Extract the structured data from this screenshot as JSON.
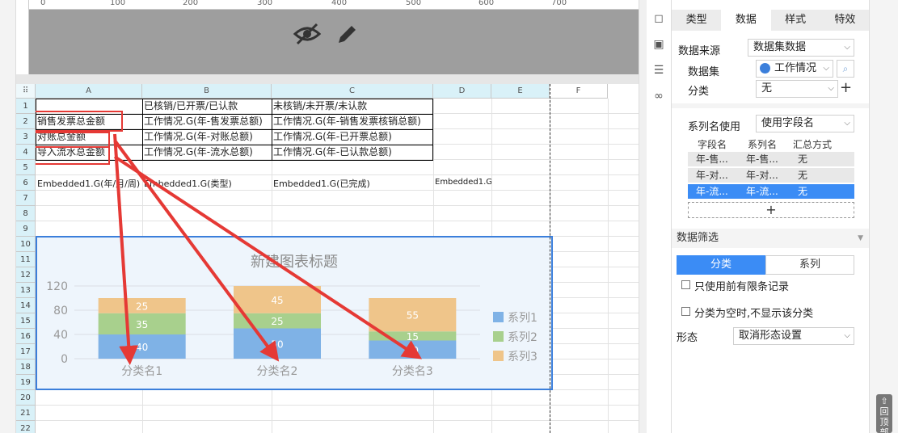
{
  "ruler_ticks": [
    "0",
    "100",
    "200",
    "300",
    "400",
    "500",
    "600",
    "700"
  ],
  "columns": [
    "A",
    "B",
    "C",
    "D",
    "E",
    "F"
  ],
  "rows": [
    "1",
    "2",
    "3",
    "4",
    "5",
    "6",
    "7",
    "8",
    "9",
    "10",
    "11",
    "12",
    "13",
    "14",
    "15",
    "16",
    "17",
    "18",
    "19",
    "20",
    "21",
    "22"
  ],
  "cells": {
    "B1": "已核销/已开票/已认款",
    "C1": "未核销/未开票/未认款",
    "A2": "销售发票总金额",
    "B2": "工作情况.G(年-售发票总额)",
    "C2": "工作情况.G(年-销售发票核销总额)",
    "A3": "对账总金额",
    "B3": "工作情况.G(年-对账总额)",
    "C3": "工作情况.G(年-已开票总额)",
    "A4": "导入流水总金额",
    "B4": "工作情况.G(年-流水总额)",
    "C4": "工作情况.G(年-已认款总额)",
    "A6": "Embedded1.G(年/月/周)",
    "B6": "Embedded1.G(类型)",
    "C6": "Embedded1.G(已完成)",
    "D6": "Embedded1.G"
  },
  "chart_data": {
    "type": "bar",
    "stacked": true,
    "title": "新建图表标题",
    "categories": [
      "分类名1",
      "分类名2",
      "分类名3"
    ],
    "series": [
      {
        "name": "系列1",
        "values": [
          40,
          50,
          30
        ],
        "color": "#7fb2e6"
      },
      {
        "name": "系列2",
        "values": [
          35,
          25,
          15
        ],
        "color": "#a8d08d"
      },
      {
        "name": "系列3",
        "values": [
          25,
          45,
          55
        ],
        "color": "#efc58a"
      }
    ],
    "data_labels": [
      [
        "40",
        "35",
        "25"
      ],
      [
        "50",
        "25",
        "45"
      ],
      [
        "10",
        "15",
        "55"
      ]
    ],
    "ylim": [
      0,
      120
    ],
    "yticks": [
      "0",
      "40",
      "80",
      "120"
    ],
    "legend": "right",
    "grid": true
  },
  "panel": {
    "tabs": [
      "类型",
      "数据",
      "样式",
      "特效"
    ],
    "active_tab": "数据",
    "data_source_label": "数据来源",
    "data_source_value": "数据集数据",
    "dataset_label": "数据集",
    "dataset_value": "工作情况",
    "category_label": "分类",
    "category_value": "无",
    "series_name_label": "系列名使用",
    "series_name_value": "使用字段名",
    "field_headers": [
      "字段名",
      "系列名",
      "汇总方式"
    ],
    "field_rows": [
      [
        "年-售...",
        "年-售...",
        "无"
      ],
      [
        "年-对...",
        "年-对...",
        "无"
      ],
      [
        "年-流...",
        "年-流...",
        "无"
      ]
    ],
    "filter_section": "数据筛选",
    "filter_tabs": [
      "分类",
      "系列"
    ],
    "checkbox_limit": "只使用前有限条记录",
    "checkbox_hide_empty": "分类为空时,不显示该分类",
    "form_label": "形态",
    "form_value": "取消形态设置",
    "add_symbol": "+"
  },
  "back_to_top": "回顶部",
  "colors": {
    "accent": "#3b8cf5",
    "arrow": "#e53935",
    "chart_border": "#3b7fdb"
  }
}
